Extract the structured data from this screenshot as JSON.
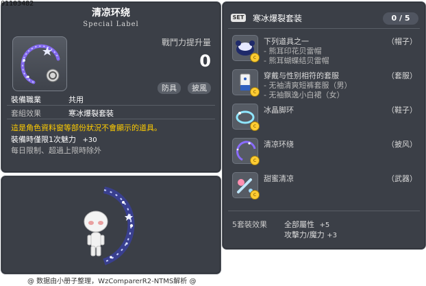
{
  "image_id_label": "01103482",
  "item": {
    "title": "清凉环绕",
    "subtitle": "Special Label",
    "power_label": "戰鬥力提升量",
    "power_value": "0",
    "tags": [
      "防具",
      "披風"
    ],
    "job_label": "裝備職業",
    "job_value": "共用",
    "set_label": "套組效果",
    "set_value": "寒冰爆裂套裝",
    "warning": "這是角色資料窗等部份狀況不會顯示的道具。",
    "equip_bonus_label": "裝備時僅限1次魅力",
    "equip_bonus_value": "+30",
    "limit_note": "每日限制、超過上限時除外"
  },
  "set": {
    "badge": "SET",
    "name": "寒冰爆裂套装",
    "count": "0 / 5",
    "items": [
      {
        "name": "下列道具之一",
        "subs": [
          "- 熊耳印花贝雷帽",
          "- 熊耳蝴蝶结贝雷帽"
        ],
        "category": "（帽子）",
        "icon": "beret-icon"
      },
      {
        "name": "穿戴与性别相符的套服",
        "subs": [
          "- 无袖清爽短裤套服（男）",
          "- 无袖飘逸小白裙（女）"
        ],
        "category": "（套服）",
        "icon": "outfit-icon"
      },
      {
        "name": "冰晶脚环",
        "subs": [],
        "category": "（鞋子）",
        "icon": "anklet-icon"
      },
      {
        "name": "清凉环绕",
        "subs": [],
        "category": "（披风）",
        "icon": "cape-ring-icon"
      },
      {
        "name": "甜蜜清凉",
        "subs": [],
        "category": "（武器）",
        "icon": "weapon-icon"
      }
    ],
    "effect_label": "5套裝效果",
    "effects": [
      {
        "label": "全部屬性",
        "value": "+5"
      },
      {
        "label": "攻擊力/魔力",
        "value": "+3"
      }
    ]
  },
  "footer": "@ 数据由小册子整理，WzComparerR2-NTMS解析 @",
  "colors": {
    "panel_bg": "#3b3f47",
    "warning": "#ffcc00",
    "coin": "#ffcc33"
  }
}
